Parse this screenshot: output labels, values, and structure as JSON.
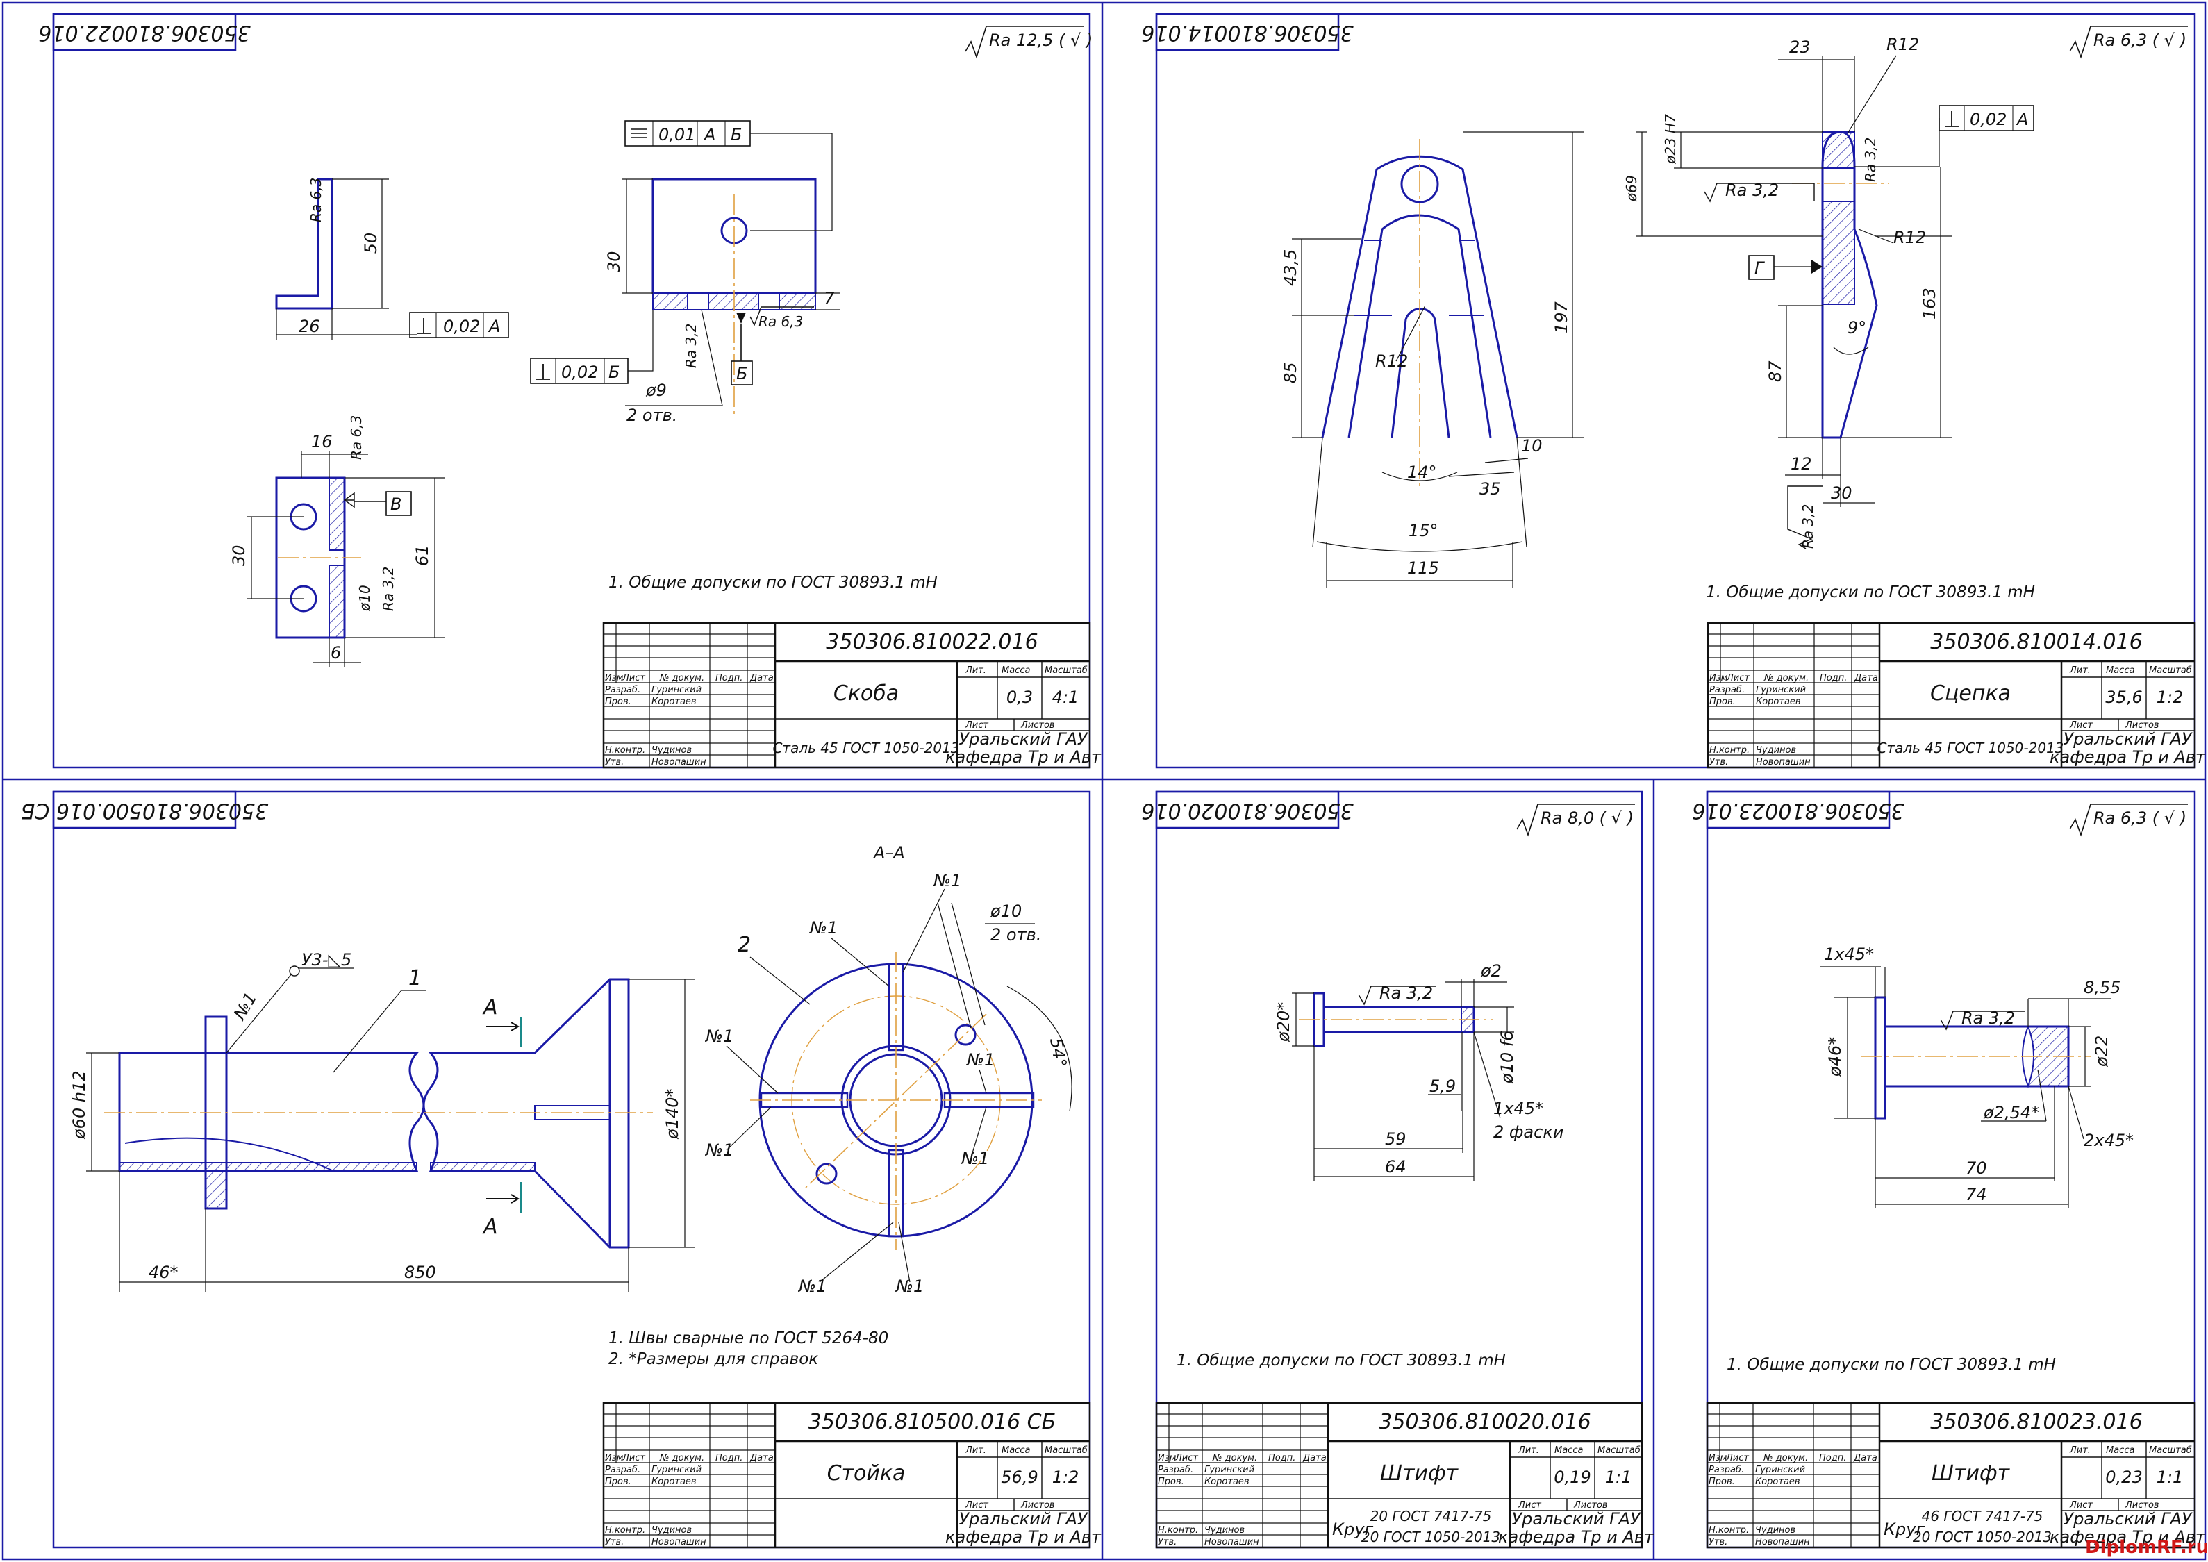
{
  "common": {
    "listov_labels": [
      "Изм",
      "Лист",
      "№ докум.",
      "Подп.",
      "Дата"
    ],
    "roles": [
      {
        "role": "Разраб.",
        "name": "Гуринский"
      },
      {
        "role": "Пров.",
        "name": "Коротаев"
      },
      {
        "role": "Н.контр.",
        "name": "Чудинов"
      },
      {
        "role": "Утв.",
        "name": "Новопашин"
      }
    ],
    "lit": "Лит.",
    "massa": "Масса",
    "masshtab": "Масштаб",
    "list": "Лист",
    "listov": "Листов",
    "org_line1": "Уральский ГАУ",
    "org_line2": "кафедра Тр и Авт"
  },
  "sheets": [
    {
      "id": "skoba",
      "code_stamp": "350306.810022.016",
      "code": "350306.810022.016",
      "name": "Скоба",
      "material": "Сталь 45 ГОСТ 1050-2013",
      "mass": "0,3",
      "scale": "4:1",
      "roughness": "Ra 12,5 ( √ )",
      "note": "1. Общие допуски по ГОСТ 30893.1 mH",
      "dims": {
        "d50": "50",
        "d26": "26",
        "ra63a": "Ra 6,3",
        "tol1": "0,02",
        "tolA": "А",
        "par": "0,01",
        "parA": "А",
        "parB": "Б",
        "d30": "30",
        "ra32": "Ra 3,2",
        "ra63b": "Ra 6,3",
        "d7": "7",
        "baseB": "Б",
        "tol2": "0,02",
        "tol2B": "Б",
        "phi9": "ø9",
        "holes": "2 отв.",
        "d16": "16",
        "ra63c": "Ra 6,3",
        "baseV": "В",
        "d30b": "30",
        "d61": "61",
        "phi10": "ø10",
        "ra32b": "Ra 3,2",
        "d6": "6"
      }
    },
    {
      "id": "scepka",
      "code_stamp": "350306.810014.016",
      "code": "350306.810014.016",
      "name": "Сцепка",
      "material": "Сталь 45 ГОСТ 1050-2013",
      "mass": "35,6",
      "scale": "1:2",
      "roughness": "Ra 6,3  ( √ )",
      "note": "1. Общие допуски по ГОСТ 30893.1 mH",
      "dims": {
        "d43": "43,5",
        "d85": "85",
        "d197": "197",
        "r12": "R12",
        "a14": "14°",
        "d35": "35",
        "d10": "10",
        "a15": "15°",
        "d115": "115",
        "d23": "23",
        "r12b": "R12",
        "phi23": "ø23 H7",
        "phi69": "ø69",
        "ra32": "Ra 3,2",
        "ra32v": "Ra 3,2",
        "tol": "0,02",
        "tolA": "А",
        "r12c": "R12",
        "baseG": "Г",
        "a9": "9°",
        "d163": "163",
        "d87": "87",
        "d12": "12",
        "d30": "30",
        "ra32c": "Ra 3,2"
      }
    },
    {
      "id": "stoika",
      "code_stamp": "350306.810500.016 СБ",
      "code": "350306.810500.016 СБ",
      "name": "Стойка",
      "material": "",
      "mass": "56,9",
      "scale": "1:2",
      "roughness": "",
      "note1": "1. Швы сварные по ГОСТ 5264-80",
      "note2": "2.  *Размеры для справок",
      "dims": {
        "weld": "№1",
        "weld_sym": "У3-◺5",
        "pos1": "1",
        "pos2": "2",
        "secA": "А",
        "secA2": "А",
        "phi60": "ø60 h12",
        "phi140": "ø140*",
        "d46": "46*",
        "d850": "850",
        "section": "А–А",
        "phi10": "ø10",
        "holes": "2 отв.",
        "a54": "54°"
      }
    },
    {
      "id": "shtift1",
      "code_stamp": "350306.810020.016",
      "code": "350306.810020.016",
      "name": "Штифт",
      "material1": "20 ГОСТ 7417-75",
      "material2": "20 ГОСТ 1050-2013",
      "krug": "Круг",
      "mass": "0,19",
      "scale": "1:1",
      "roughness": "Ra 8,0  ( √ )",
      "note": "1. Общие допуски по ГОСТ 30893.1 mH",
      "dims": {
        "phi20": "ø20*",
        "ra32": "Ra 3,2",
        "phi2": "ø2",
        "phi10": "ø10 f6",
        "d59a": "5,9",
        "ch": "1x45*",
        "fas": "2 фаски",
        "d59": "59",
        "d64": "64"
      }
    },
    {
      "id": "shtift2",
      "code_stamp": "350306.810023.016",
      "code": "350306.810023.016",
      "name": "Штифт",
      "material1": "46 ГОСТ 7417-75",
      "material2": "20 ГОСТ 1050-2013",
      "krug": "Круг",
      "mass": "0,23",
      "scale": "1:1",
      "roughness": "Ra 6,3  ( √ )",
      "note": "1. Общие допуски по ГОСТ 30893.1 mH",
      "dims": {
        "ch1": "1x45*",
        "d855": "8,55",
        "ra32": "Ra 3,2",
        "phi46": "ø46*",
        "phi22": "ø22",
        "phi254": "ø2,54*",
        "ch2": "2x45*",
        "d70": "70",
        "d74": "74"
      }
    }
  ],
  "watermark": "DiplomRF.ru"
}
